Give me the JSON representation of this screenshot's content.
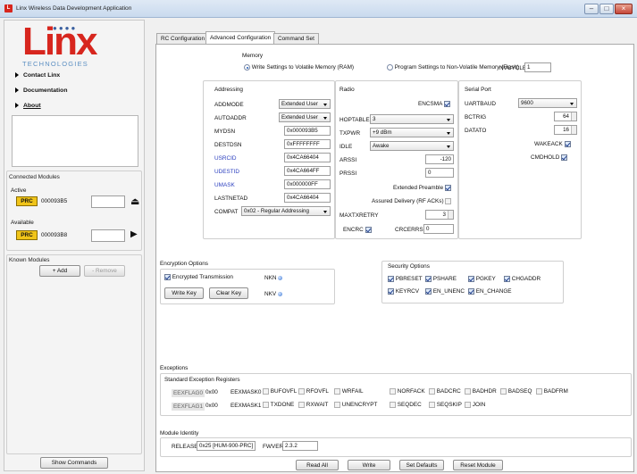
{
  "window": {
    "title": "Linx Wireless Data Development Application",
    "app_icon": "L"
  },
  "sidebar": {
    "logo": "Linx",
    "logo_sub": "TECHNOLOGIES",
    "nav": [
      {
        "label": "Contact Linx"
      },
      {
        "label": "Documentation"
      },
      {
        "label": "About"
      }
    ],
    "connected_title": "Connected Modules",
    "active_label": "Active",
    "active_module": {
      "badge": "PRC",
      "id": "000093B5"
    },
    "available_label": "Available",
    "available_module": {
      "badge": "PRC",
      "id": "000093B8"
    },
    "known_title": "Known Modules",
    "add_label": "+ Add",
    "remove_label": "- Remove",
    "show_commands_label": "Show Commands"
  },
  "tabs": [
    {
      "label": "RC Configuration"
    },
    {
      "label": "Advanced Configuration"
    },
    {
      "label": "Command Set"
    }
  ],
  "memory": {
    "title": "Memory",
    "volatile_label": "Write Settings to Volatile Memory (RAM)",
    "nonvolatile_label": "Program Settings to Non-Volatile Memory (Flash)",
    "nvcycle_label": "NVCYCLE",
    "nvcycle_value": "1"
  },
  "addressing": {
    "title": "Addressing",
    "addmode_label": "ADDMODE",
    "addmode_value": "Extended User",
    "autoaddr_label": "AUTOADDR",
    "autoaddr_value": "Extended User",
    "mydsn_label": "MYDSN",
    "mydsn_value": "0x000093B5",
    "destdsn_label": "DESTDSN",
    "destdsn_value": "0xFFFFFFFF",
    "usrcid_label": "USRCID",
    "usrcid_value": "0x4CA66404",
    "udestid_label": "UDESTID",
    "udestid_value": "0x4CA664FF",
    "umask_label": "UMASK",
    "umask_value": "0x000000FF",
    "lastnetad_label": "LASTNETAD",
    "lastnetad_value": "0x4CA66404",
    "compat_label": "COMPAT",
    "compat_value": "0x02 - Regular Addressing"
  },
  "radio": {
    "title": "Radio",
    "encsma_label": "ENCSMA",
    "hoptable_label": "HOPTABLE",
    "hoptable_value": "3",
    "txpwr_label": "TXPWR",
    "txpwr_value": "+9 dBm",
    "idle_label": "IDLE",
    "idle_value": "Awake",
    "arssi_label": "ARSSI",
    "arssi_value": "-120",
    "prssi_label": "PRSSI",
    "prssi_value": "0",
    "extended_preamble_label": "Extended Preamble",
    "assured_delivery_label": "Assured Delivery (RF ACKs)",
    "maxtxretry_label": "MAXTXRETRY",
    "maxtxretry_value": "3",
    "encrc_label": "ENCRC",
    "crcerrs_label": "CRCERRS",
    "crcerrs_value": "0"
  },
  "serial": {
    "title": "Serial Port",
    "uartbaud_label": "UARTBAUD",
    "uartbaud_value": "9600",
    "bctrig_label": "BCTRIG",
    "bctrig_value": "64",
    "datato_label": "DATATO",
    "datato_value": "16",
    "wakeack_label": "WAKEACK",
    "cmdhold_label": "CMDHOLD"
  },
  "encryption": {
    "title": "Encryption Options",
    "encrypted_label": "Encrypted Transmission",
    "nkn_label": "NKN",
    "nkv_label": "NKV",
    "write_key_label": "Write Key",
    "clear_key_label": "Clear Key"
  },
  "security": {
    "title": "Security Options",
    "row1": [
      "PBRESET",
      "PSHARE",
      "PGKEY",
      "CHGADDR"
    ],
    "row2": [
      "KEYRCV",
      "EN_UNENC",
      "EN_CHANGE"
    ]
  },
  "exceptions": {
    "title": "Exceptions",
    "subtitle": "Standard Exception Registers",
    "flag0": "EEXFLAG0",
    "flag0_value": "0x00",
    "flag1": "EEXFLAG1",
    "flag1_value": "0x00",
    "mask0": "EEXMASK0",
    "mask1": "EEXMASK1",
    "row1": [
      "BUFOVFL",
      "RFOVFL",
      "WRFAIL",
      "NORFACK",
      "BADCRC",
      "BADHDR",
      "BADSEQ",
      "BADFRM"
    ],
    "row2": [
      "TXDONE",
      "RXWAIT",
      "UNENCRYPT",
      "SEQDEC",
      "SEQSKIP",
      "JOIN"
    ]
  },
  "identity": {
    "title": "Module Identity",
    "release_label": "RELEASE",
    "release_value": "0x25 [HUM-900-PRC]",
    "fwver_label": "FWVER",
    "fwver_value": "2.3.2"
  },
  "footer": {
    "read_all": "Read All",
    "write": "Write",
    "set_defaults": "Set Defaults",
    "reset_module": "Reset Module"
  }
}
